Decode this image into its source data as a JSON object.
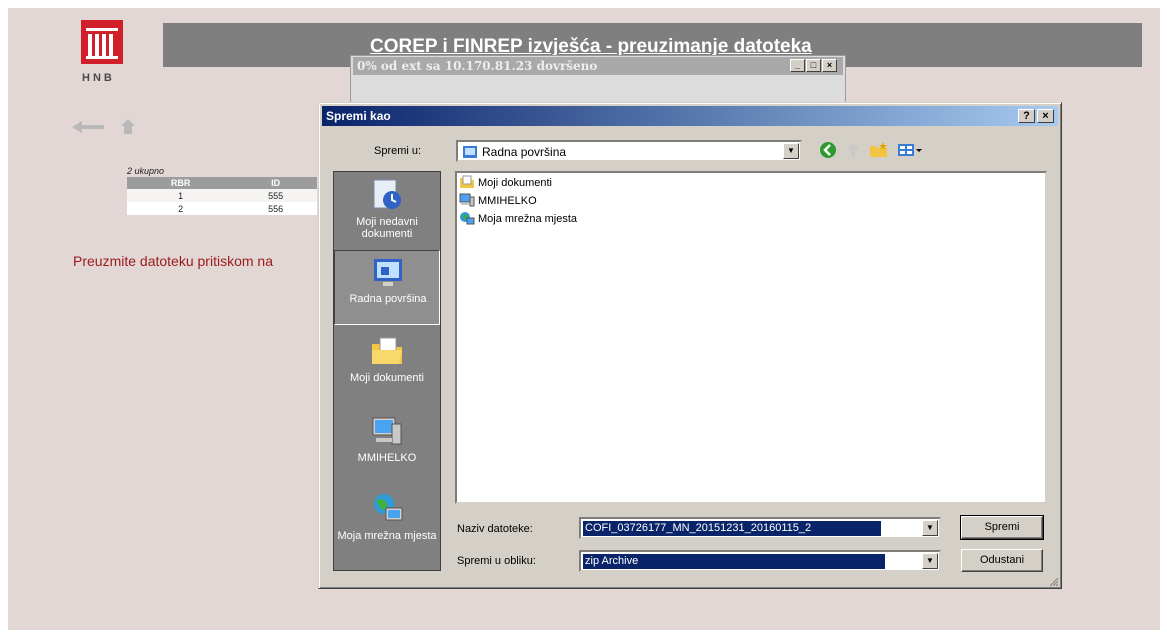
{
  "page": {
    "logo_text": "HNB",
    "header_title": "COREP i FINREP izvješća - preuzimanje datoteka",
    "summary_label": "2 ukupno",
    "table": {
      "columns": [
        "RBR",
        "ID"
      ],
      "rows": [
        [
          "1",
          "555"
        ],
        [
          "2",
          "556"
        ]
      ]
    },
    "download_text": "Preuzmite datoteku pritiskom na",
    "nav": [
      "back-arrow-icon",
      "home-icon"
    ]
  },
  "progress_window": {
    "title": "0% od ext sa 10.170.81.23 dovršeno",
    "buttons": [
      "_",
      "□",
      "×"
    ]
  },
  "dialog": {
    "title": "Spremi kao",
    "title_buttons": [
      "?",
      "×"
    ],
    "save_in_label": "Spremi u:",
    "save_in_value": "Radna površina",
    "places": [
      {
        "label": "Moji nedavni dokumenti",
        "icon": "recent-documents-icon"
      },
      {
        "label": "Radna površina",
        "icon": "desktop-icon"
      },
      {
        "label": "Moji dokumenti",
        "icon": "my-documents-icon"
      },
      {
        "label": "MMIHELKO",
        "icon": "my-computer-icon"
      },
      {
        "label": "Moja mrežna mjesta",
        "icon": "network-places-icon"
      }
    ],
    "files": [
      {
        "name": "Moji dokumenti",
        "icon": "folder-icon"
      },
      {
        "name": "MMIHELKO",
        "icon": "computer-icon"
      },
      {
        "name": "Moja mrežna mjesta",
        "icon": "network-icon"
      }
    ],
    "filename_label": "Naziv datoteke:",
    "filename_value": "COFI_03726177_MN_20151231_20160115_2",
    "filetype_label": "Spremi u obliku:",
    "filetype_value": "zip Archive",
    "save_button": "Spremi",
    "cancel_button": "Odustani"
  },
  "colors": {
    "page_bg": "#e2d7d5",
    "header_bar": "#7f7f7f",
    "logo_red": "#d1202a",
    "title_bar_start": "#0a246a",
    "title_bar_end": "#a6caf0",
    "dialog_face": "#d4d0c8",
    "places_bg": "#808080",
    "download_text": "#9b1b1b"
  }
}
